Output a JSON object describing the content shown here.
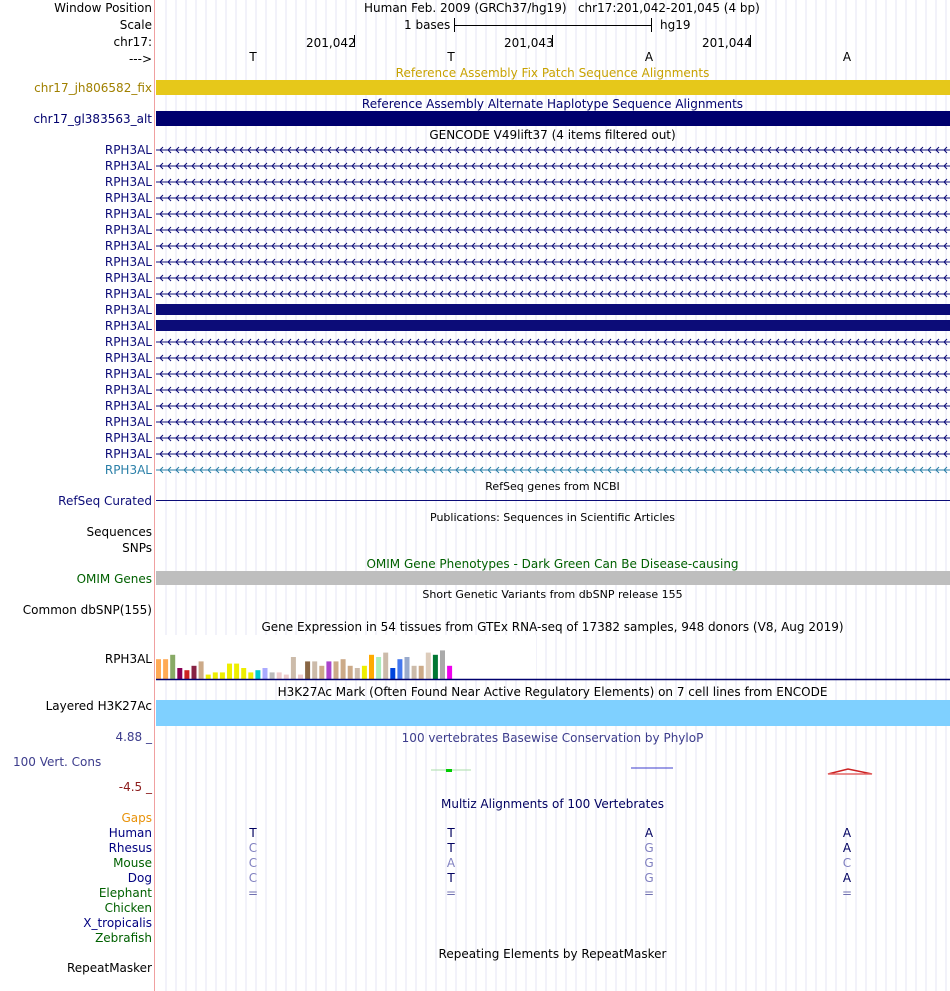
{
  "header": {
    "window_position_label": "Window Position",
    "scale_label": "Scale",
    "chrom_label": "chr17:",
    "strand_label": "--->",
    "title": "Human Feb. 2009 (GRCh37/hg19)   chr17:201,042-201,045 (4 bp)",
    "scale_text": "1 bases",
    "assembly": "hg19",
    "positions": [
      "201,042",
      "201,043",
      "201,044"
    ],
    "bases": [
      "T",
      "T",
      "A",
      "A"
    ]
  },
  "tracks": {
    "fix_patch": {
      "title": "Reference Assembly Fix Patch Sequence Alignments",
      "label": "chr17_jh806582_fix",
      "color": "#e6c81a"
    },
    "alt_haplo": {
      "title": "Reference Assembly Alternate Haplotype Sequence Alignments",
      "label": "chr17_gl383563_alt",
      "color": "#00006e"
    },
    "gencode": {
      "title": "GENCODE V49lift37 (4 items filtered out)",
      "rows": [
        {
          "label": "RPH3AL",
          "style": "intron"
        },
        {
          "label": "RPH3AL",
          "style": "intron"
        },
        {
          "label": "RPH3AL",
          "style": "intron"
        },
        {
          "label": "RPH3AL",
          "style": "intron"
        },
        {
          "label": "RPH3AL",
          "style": "intron"
        },
        {
          "label": "RPH3AL",
          "style": "intron"
        },
        {
          "label": "RPH3AL",
          "style": "intron"
        },
        {
          "label": "RPH3AL",
          "style": "intron"
        },
        {
          "label": "RPH3AL",
          "style": "intron"
        },
        {
          "label": "RPH3AL",
          "style": "intron"
        },
        {
          "label": "RPH3AL",
          "style": "exon"
        },
        {
          "label": "RPH3AL",
          "style": "exon"
        },
        {
          "label": "RPH3AL",
          "style": "intron"
        },
        {
          "label": "RPH3AL",
          "style": "intron"
        },
        {
          "label": "RPH3AL",
          "style": "intron"
        },
        {
          "label": "RPH3AL",
          "style": "intron"
        },
        {
          "label": "RPH3AL",
          "style": "intron"
        },
        {
          "label": "RPH3AL",
          "style": "intron"
        },
        {
          "label": "RPH3AL",
          "style": "intron"
        },
        {
          "label": "RPH3AL",
          "style": "intron"
        },
        {
          "label": "RPH3AL",
          "style": "intron-teal"
        }
      ]
    },
    "refseq": {
      "title": "RefSeq genes from NCBI",
      "label": "RefSeq Curated"
    },
    "publications": {
      "title": "Publications: Sequences in Scientific Articles",
      "label_line1": "Sequences",
      "label_line2": "SNPs"
    },
    "omim": {
      "title": "OMIM Gene Phenotypes - Dark Green Can Be Disease-causing",
      "label": "OMIM Genes",
      "color": "#bebebe"
    },
    "dbsnp": {
      "title": "Short Genetic Variants from dbSNP release 155",
      "label": "Common dbSNP(155)"
    },
    "gtex": {
      "title": "Gene Expression in 54 tissues from GTEx RNA-seq of 17382 samples, 948 donors (V8, Aug 2019)",
      "label": "RPH3AL",
      "bar_colors": [
        "#ffaa55",
        "#ffaa55",
        "#88aa66",
        "#880055",
        "#cc2222",
        "#882244",
        "#ccaa88",
        "#eeee00",
        "#eeee00",
        "#eeee00",
        "#eeee00",
        "#eeee00",
        "#eeee00",
        "#eeee00",
        "#00cccc",
        "#aaaaff",
        "#bbbbbb",
        "#eecccc",
        "#eecccc",
        "#ccbbaa",
        "#eecccc",
        "#886644",
        "#ccbbaa",
        "#ccaa88",
        "#aa44cc",
        "#ccaa88",
        "#ccaa88",
        "#ccaa88",
        "#ccbbaa",
        "#eeee00",
        "#ffaa00",
        "#aaeebb",
        "#ccbbaa",
        "#0044dd",
        "#4477ee",
        "#99aacc",
        "#ccbbaa",
        "#ccaa88",
        "#ddccbb",
        "#007733",
        "#aaaaaa",
        "#ee00ee"
      ],
      "values": [
        0.45,
        0.45,
        0.55,
        0.25,
        0.2,
        0.3,
        0.4,
        0.1,
        0.15,
        0.15,
        0.35,
        0.35,
        0.25,
        0.15,
        0.2,
        0.25,
        0.15,
        0.15,
        0.1,
        0.5,
        0.1,
        0.4,
        0.4,
        0.3,
        0.4,
        0.4,
        0.45,
        0.3,
        0.25,
        0.3,
        0.55,
        0.5,
        0.6,
        0.25,
        0.45,
        0.5,
        0.3,
        0.3,
        0.6,
        0.55,
        0.65,
        0.3
      ]
    },
    "h3k27ac": {
      "title": "H3K27Ac Mark (Often Found Near Active Regulatory Elements) on 7 cell lines from ENCODE",
      "label": "Layered H3K27Ac",
      "color": "#7fd0ff"
    },
    "phylop": {
      "title": "100 vertebrates Basewise Conservation by PhyloP",
      "label": "100 Vert. Cons",
      "max": "4.88 _",
      "min": "-4.5 _"
    },
    "multiz": {
      "title": "Multiz Alignments of 100 Vertebrates",
      "species": [
        {
          "name": "Gaps",
          "color": "#e8920a",
          "bases": [
            "",
            "",
            "",
            ""
          ],
          "base_color": "#000"
        },
        {
          "name": "Human",
          "color": "#000080",
          "bases": [
            "T",
            "T",
            "A",
            "A"
          ],
          "base_color": "#000060"
        },
        {
          "name": "Rhesus",
          "color": "#000080",
          "bases": [
            "C",
            "T",
            "G",
            "A"
          ],
          "base_color": "#000060"
        },
        {
          "name": "Mouse",
          "color": "#006000",
          "bases": [
            "C",
            "A",
            "G",
            "C"
          ],
          "base_color": "#000060"
        },
        {
          "name": "Dog",
          "color": "#000080",
          "bases": [
            "C",
            "T",
            "G",
            "A"
          ],
          "base_color": "#000060"
        },
        {
          "name": "Elephant",
          "color": "#006000",
          "bases": [
            "=",
            "=",
            "=",
            "="
          ],
          "base_color": "#7070b0"
        },
        {
          "name": "Chicken",
          "color": "#006000",
          "bases": [
            "",
            "",
            "",
            ""
          ],
          "base_color": "#000"
        },
        {
          "name": "X_tropicalis",
          "color": "#000080",
          "bases": [
            "",
            "",
            "",
            ""
          ],
          "base_color": "#000"
        },
        {
          "name": "Zebrafish",
          "color": "#006000",
          "bases": [
            "",
            "",
            "",
            ""
          ],
          "base_color": "#000"
        }
      ]
    },
    "repeatmasker": {
      "title": "Repeating Elements by RepeatMasker",
      "label": "RepeatMasker"
    }
  }
}
